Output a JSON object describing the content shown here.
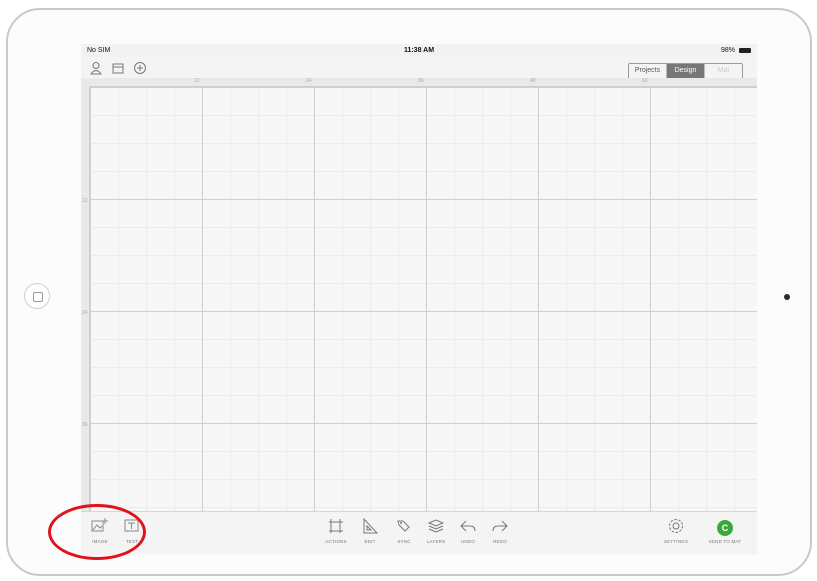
{
  "status_bar": {
    "carrier": "No SIM",
    "time": "11:38 AM",
    "battery": "98%"
  },
  "top_bar": {
    "icons": [
      "user-icon",
      "folder-icon",
      "plus-circle-icon"
    ],
    "segments": {
      "projects": "Projects",
      "design": "Design",
      "mat": "Mat"
    }
  },
  "ruler": {
    "top_marks": [
      "12",
      "24",
      "36",
      "48",
      "60"
    ],
    "left_marks": [
      "12",
      "24",
      "36"
    ]
  },
  "toolbar": {
    "image": {
      "label": "IMAGE",
      "icon": "image-add-icon"
    },
    "text": {
      "label": "TEXT",
      "icon": "text-icon"
    },
    "actions": {
      "label": "ACTIONS",
      "icon": "actions-icon"
    },
    "edit": {
      "label": "EDIT",
      "icon": "edit-icon"
    },
    "sync": {
      "label": "SYNC",
      "icon": "sync-icon"
    },
    "layers": {
      "label": "LAYERS",
      "icon": "layers-icon"
    },
    "undo": {
      "label": "UNDO",
      "icon": "undo-icon"
    },
    "redo": {
      "label": "REDO",
      "icon": "redo-icon"
    },
    "settings": {
      "label": "SETTINGS",
      "icon": "gear-icon"
    },
    "send_to_mat": {
      "label": "SEND TO MAT",
      "badge": "C",
      "color": "#3aa83a"
    }
  },
  "highlight_color": "#e0131b"
}
